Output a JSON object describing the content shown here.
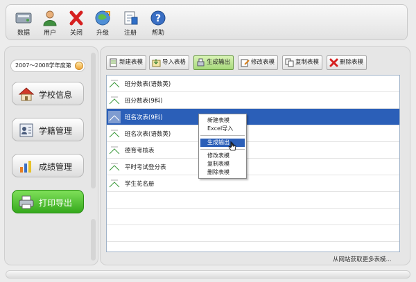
{
  "toolbar": {
    "items": [
      {
        "label": "数据",
        "icon": "database-icon"
      },
      {
        "label": "用户",
        "icon": "user-icon"
      },
      {
        "label": "关闭",
        "icon": "close-icon"
      },
      {
        "label": "升级",
        "icon": "upgrade-icon"
      },
      {
        "label": "注册",
        "icon": "register-icon"
      },
      {
        "label": "帮助",
        "icon": "help-icon"
      }
    ]
  },
  "sidebar": {
    "year": "2007～2008学年度第",
    "nav": [
      {
        "label": "学校信息",
        "icon": "school-icon"
      },
      {
        "label": "学籍管理",
        "icon": "student-record-icon"
      },
      {
        "label": "成绩管理",
        "icon": "grades-icon"
      },
      {
        "label": "打印导出",
        "icon": "printer-icon",
        "active": true
      }
    ]
  },
  "actions": [
    {
      "label": "新建表模",
      "icon": "new-template-icon"
    },
    {
      "label": "导入表格",
      "icon": "import-icon"
    },
    {
      "label": "生成输出",
      "icon": "generate-icon",
      "pressed": true
    },
    {
      "label": "修改表模",
      "icon": "edit-icon"
    },
    {
      "label": "复制表模",
      "icon": "copy-icon"
    },
    {
      "label": "删除表模",
      "icon": "delete-icon"
    }
  ],
  "templates": [
    {
      "label": "班分数表(语数英)"
    },
    {
      "label": "班分数表(9科)"
    },
    {
      "label": "班名次表(9科)",
      "selected": true
    },
    {
      "label": "班名次表(语数英)"
    },
    {
      "label": "德育考核表"
    },
    {
      "label": "平时考试登分表"
    },
    {
      "label": "学生花名册"
    }
  ],
  "context_menu": {
    "items": [
      "新建表模",
      "Excel导入",
      "生成输出",
      "修改表模",
      "复制表模",
      "删除表模"
    ],
    "highlighted": "生成输出"
  },
  "footer": {
    "link": "从网站获取更多表模..."
  },
  "colors": {
    "selection": "#2b5fb8",
    "active_nav": "#35a91c"
  }
}
